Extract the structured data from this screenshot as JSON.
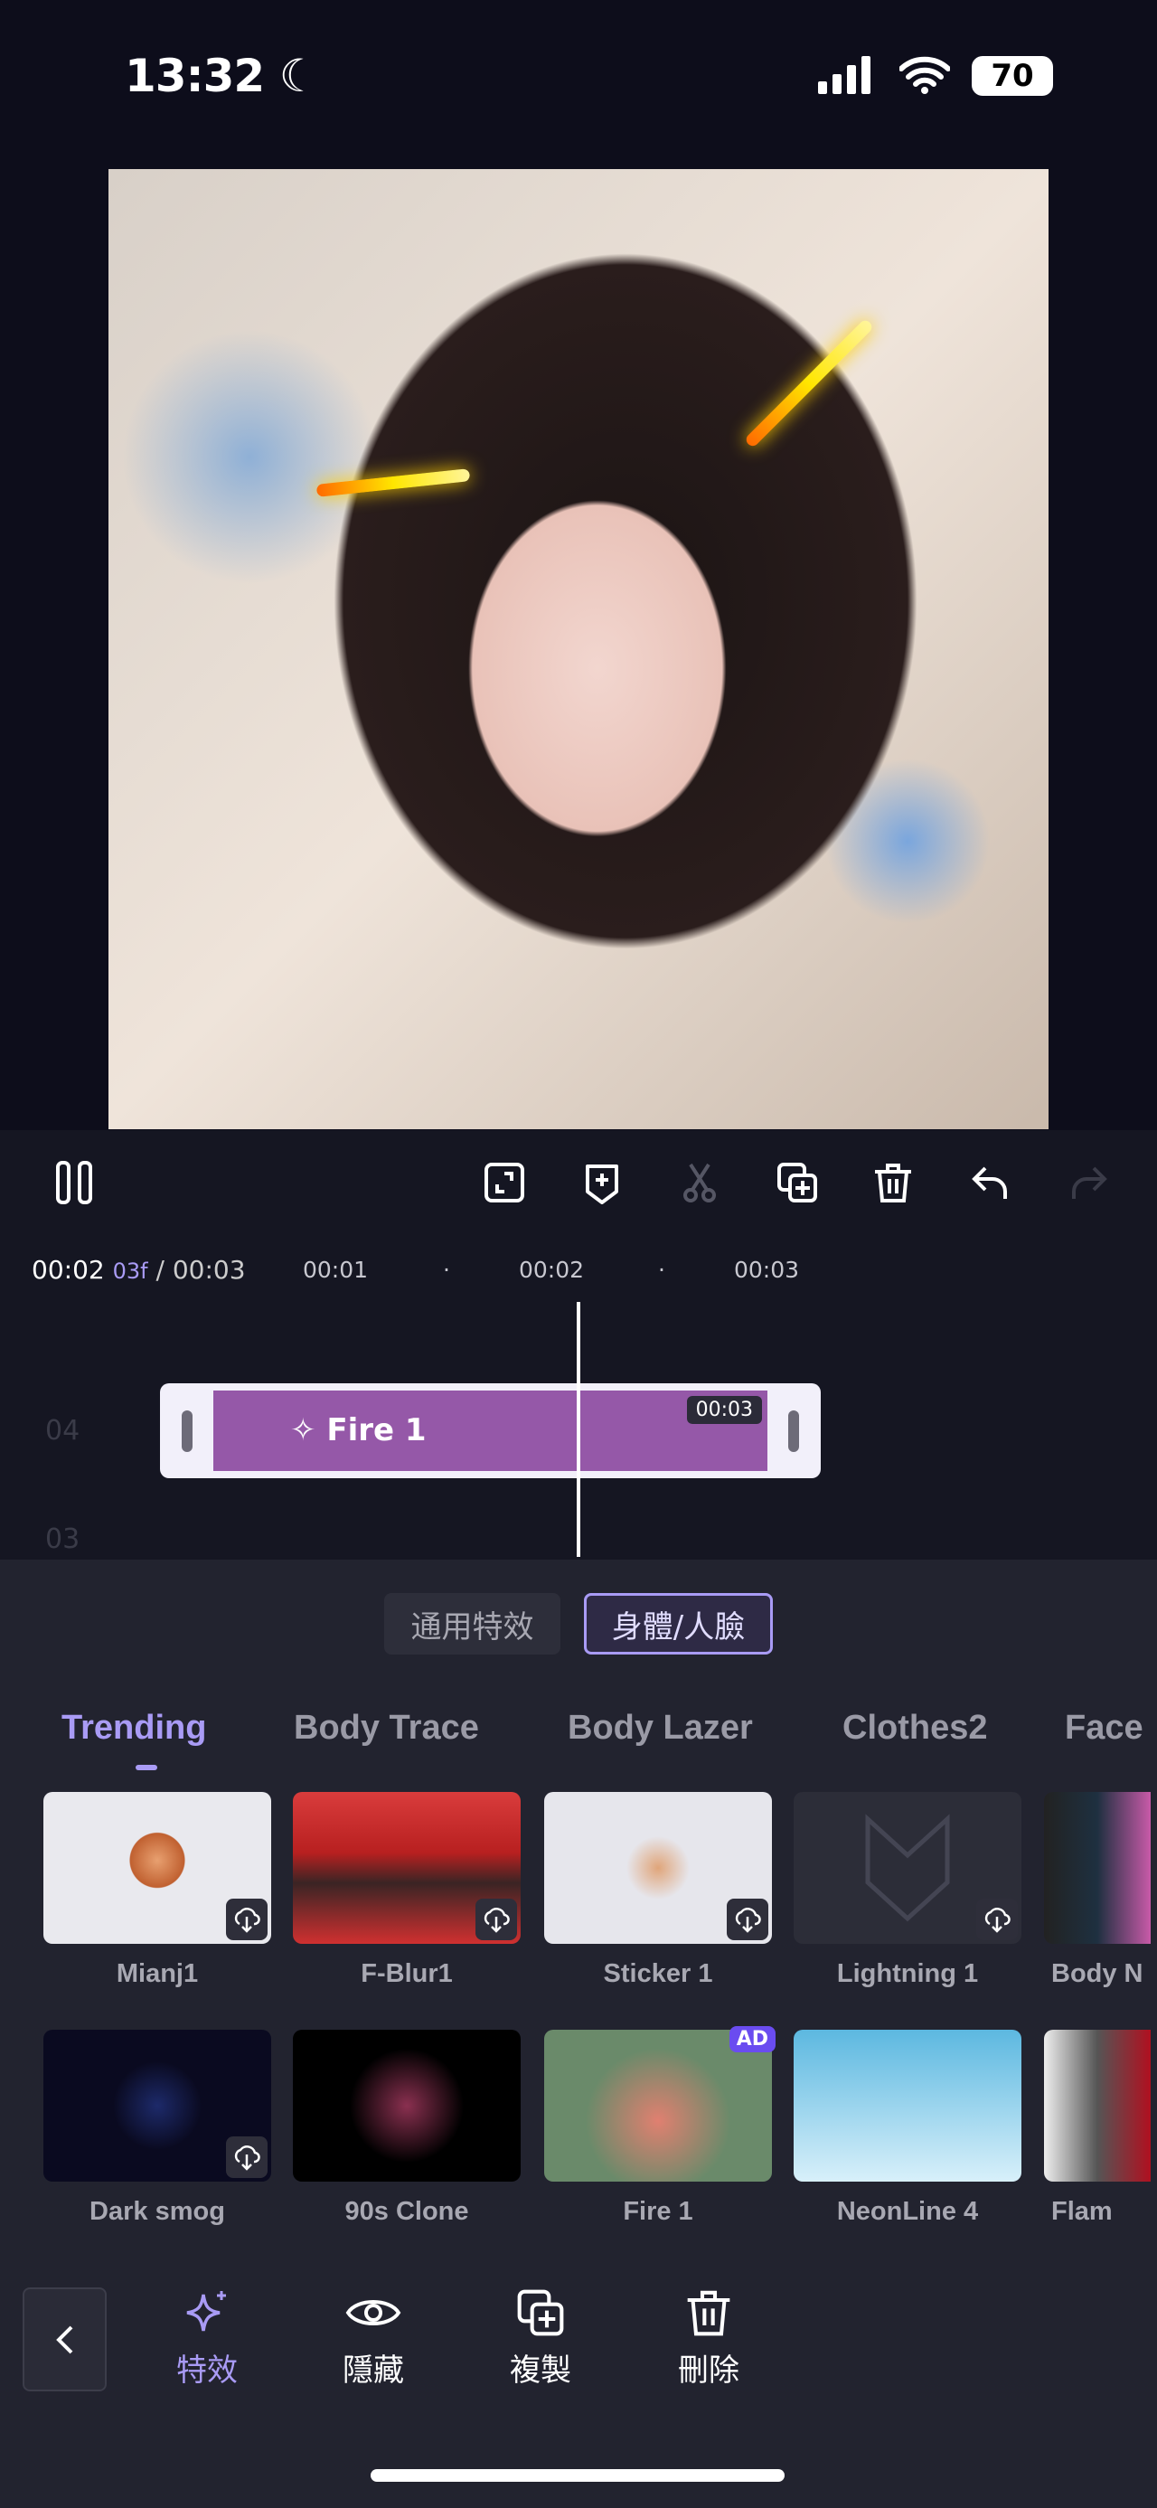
{
  "status": {
    "time": "13:32",
    "battery": "70"
  },
  "toolbar": {
    "icons": [
      "pause-icon",
      "fullscreen-icon",
      "add-keyframe-icon",
      "split-icon",
      "duplicate-icon",
      "delete-icon",
      "undo-icon",
      "redo-icon"
    ]
  },
  "timeline": {
    "current": "00:02",
    "frame": "03f",
    "total": "/ 00:03",
    "ticks": [
      "00:01",
      "00:02",
      "00:03"
    ],
    "tracks": [
      "04",
      "03"
    ],
    "clip": {
      "label": "Fire 1",
      "duration": "00:03",
      "color": "#9558a8"
    }
  },
  "segments": [
    {
      "label": "通用特效",
      "active": false
    },
    {
      "label": "身體/人臉",
      "active": true
    }
  ],
  "categories": [
    "Trending",
    "Body Trace",
    "Body Lazer",
    "Clothes2",
    "Face"
  ],
  "effects_row1": [
    "Mianj1",
    "F-Blur1",
    "Sticker 1",
    "Lightning 1",
    "Body N"
  ],
  "effects_row2": [
    "Dark smog",
    "90s Clone",
    "Fire 1",
    "NeonLine 4",
    "Flam"
  ],
  "ad_badge": "AD",
  "bottom_nav": [
    {
      "label": "特效",
      "icon": "sparkle-icon",
      "active": true
    },
    {
      "label": "隱藏",
      "icon": "eye-icon"
    },
    {
      "label": "複製",
      "icon": "duplicate-icon"
    },
    {
      "label": "刪除",
      "icon": "trash-icon"
    }
  ],
  "colors": {
    "accent": "#a99bf5",
    "clip": "#9558a8"
  }
}
